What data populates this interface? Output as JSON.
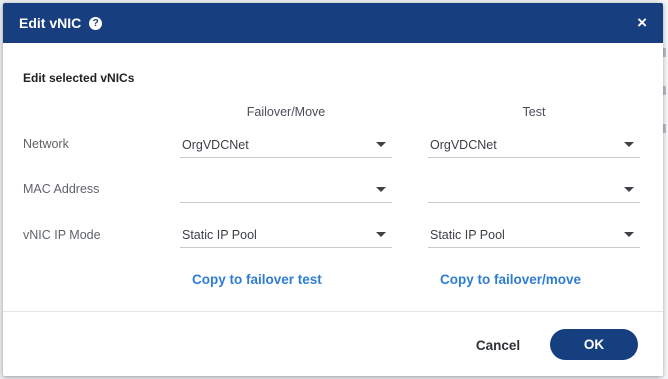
{
  "dialog": {
    "title": "Edit vNIC",
    "help_icon_glyph": "?",
    "close_icon_glyph": "×",
    "header_color": "#173f80"
  },
  "section": {
    "title": "Edit selected vNICs"
  },
  "columns": {
    "failover": "Failover/Move",
    "test": "Test"
  },
  "rows": {
    "network": {
      "label": "Network",
      "failover_value": "OrgVDCNet",
      "test_value": "OrgVDCNet"
    },
    "mac": {
      "label": "MAC Address",
      "failover_value": "",
      "test_value": ""
    },
    "ip_mode": {
      "label": "vNIC IP Mode",
      "failover_value": "Static IP Pool",
      "test_value": "Static IP Pool"
    }
  },
  "links": {
    "copy_to_test": "Copy to failover test",
    "copy_to_failover": "Copy to failover/move"
  },
  "footer": {
    "cancel_label": "Cancel",
    "ok_label": "OK"
  },
  "colors": {
    "accent": "#163f80",
    "link": "#2f7dd3"
  }
}
